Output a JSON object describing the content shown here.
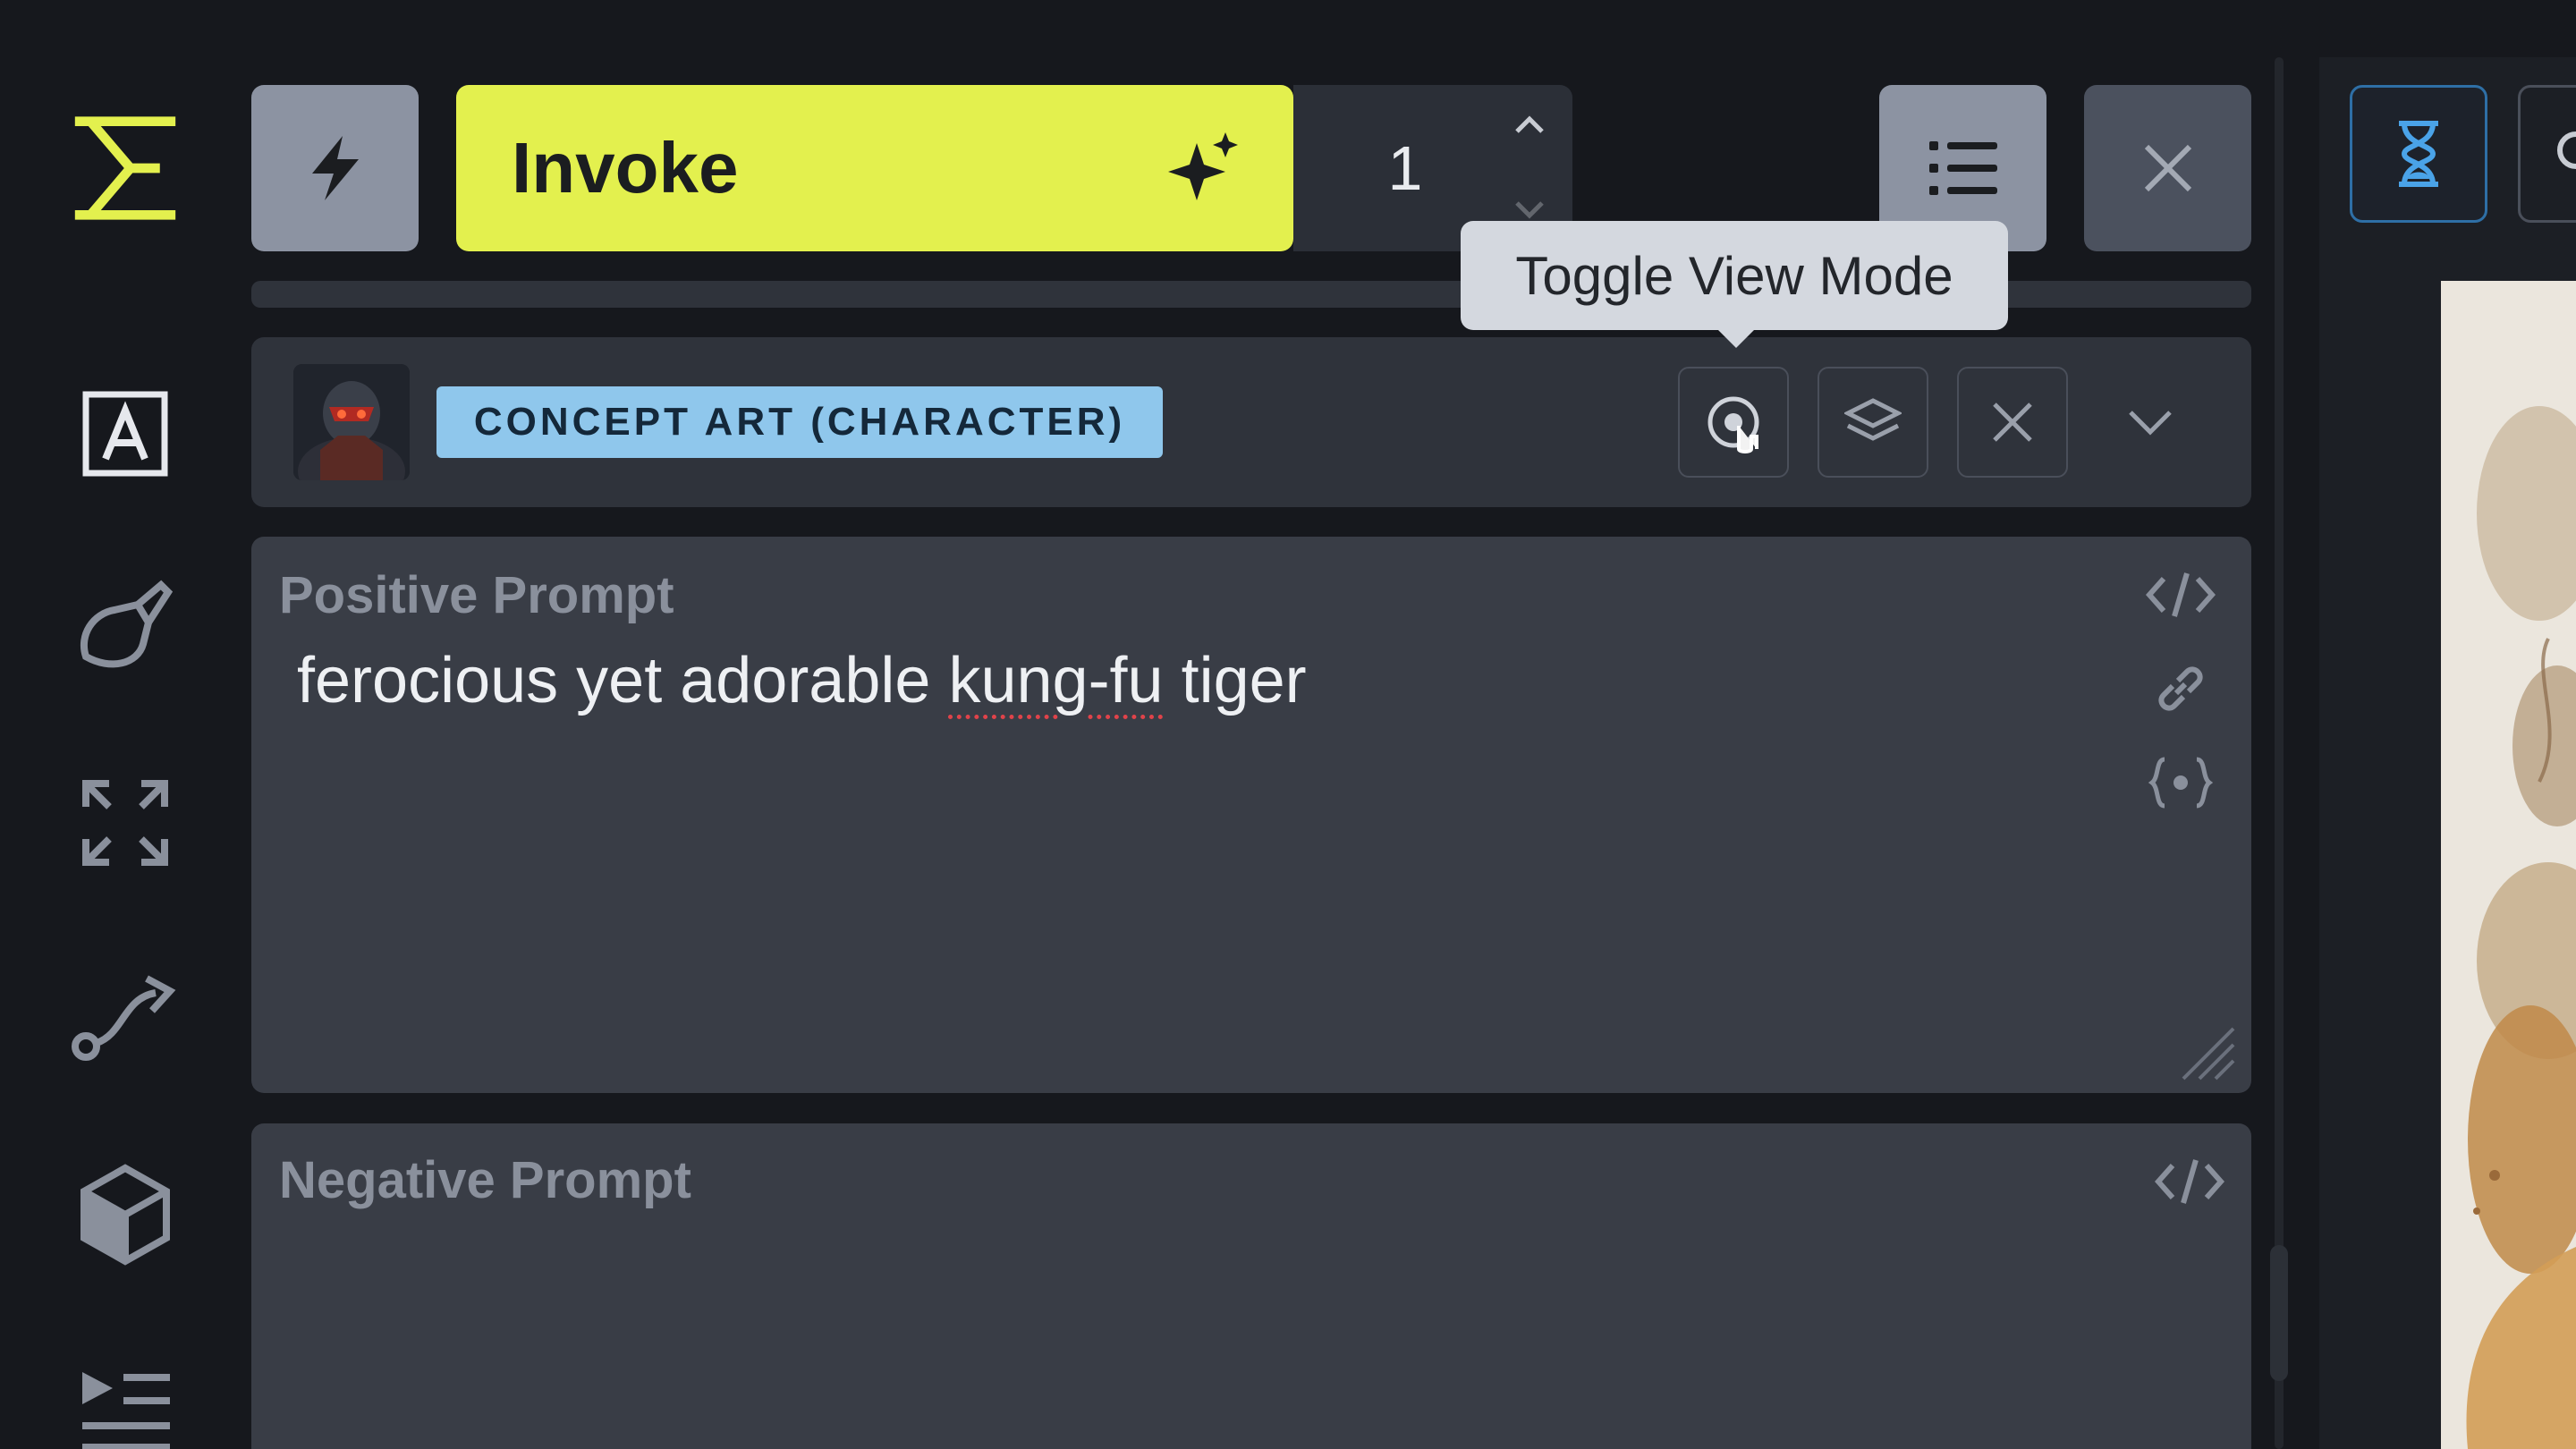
{
  "toolbar": {
    "invoke_label": "Invoke",
    "iterations_value": "1"
  },
  "tooltip": {
    "text": "Toggle View Mode"
  },
  "style_preset": {
    "name": "CONCEPT ART (CHARACTER)"
  },
  "positive_prompt": {
    "label": "Positive Prompt",
    "value_before": "ferocious yet adorable ",
    "value_flagged": "kung-fu",
    "value_after": " tiger"
  },
  "negative_prompt": {
    "label": "Negative Prompt",
    "value": ""
  },
  "colors": {
    "accent": "#e3f04e",
    "preset_tag": "#8fc7ec",
    "background": "#16181d",
    "panel": "#393d46"
  },
  "icons": {
    "sidebar": [
      "invoke-logo-icon",
      "text-to-image-icon",
      "canvas-brush-icon",
      "upscale-icon",
      "workflow-icon",
      "model-cube-icon",
      "queue-icon"
    ],
    "toolbar": [
      "lightning-icon",
      "sparkles-icon",
      "list-icon",
      "close-icon"
    ],
    "preset": [
      "view-mode-icon",
      "layers-icon",
      "close-icon",
      "chevron-down-icon"
    ],
    "prompt": [
      "code-icon",
      "link-icon",
      "dynamic-prompt-icon"
    ]
  }
}
